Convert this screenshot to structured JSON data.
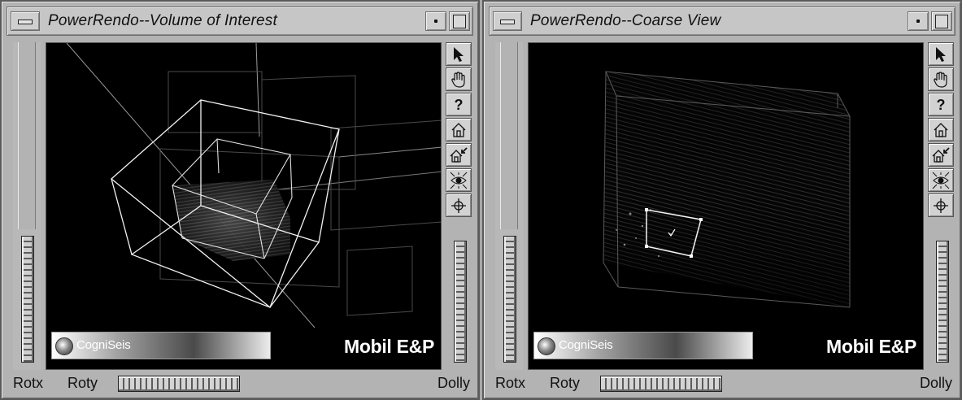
{
  "windows": [
    {
      "title": "PowerRendo--Volume of Interest",
      "logo_text": "CogniSeis",
      "watermark": "Mobil E&P",
      "labels": {
        "rotx": "Rotx",
        "roty": "Roty",
        "dolly": "Dolly"
      },
      "toolbar": [
        "pointer-icon",
        "hand-icon",
        "help-icon",
        "home-icon",
        "set-home-icon",
        "view-all-icon",
        "seek-icon"
      ]
    },
    {
      "title": "PowerRendo--Coarse View",
      "logo_text": "CogniSeis",
      "watermark": "Mobil E&P",
      "labels": {
        "rotx": "Rotx",
        "roty": "Roty",
        "dolly": "Dolly"
      },
      "toolbar": [
        "pointer-icon",
        "hand-icon",
        "help-icon",
        "home-icon",
        "set-home-icon",
        "view-all-icon",
        "seek-icon"
      ]
    }
  ],
  "help_glyph": "?",
  "colors": {
    "window_bg": "#b3b3b3",
    "viewport_bg": "#000000",
    "wireframe": "#ffffff"
  }
}
